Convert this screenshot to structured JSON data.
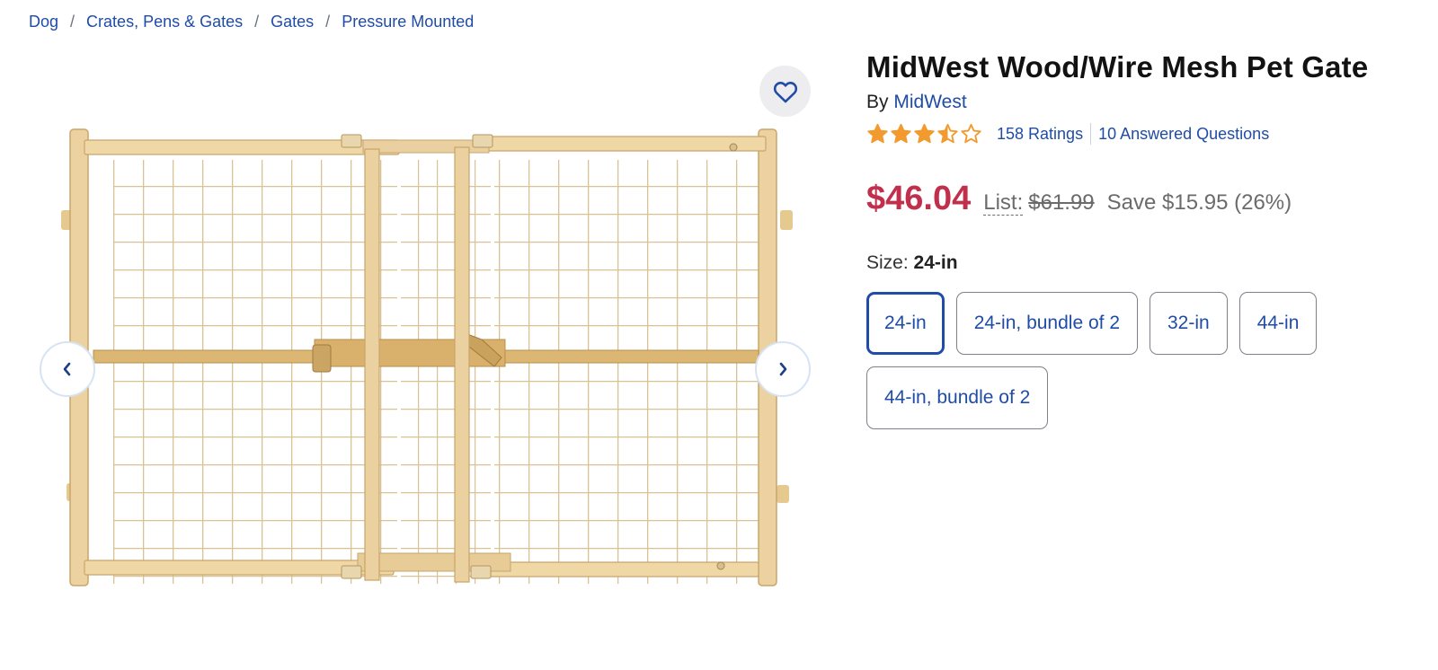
{
  "breadcrumb": [
    "Dog",
    "Crates, Pens & Gates",
    "Gates",
    "Pressure Mounted"
  ],
  "breadcrumb_separator": "/",
  "product": {
    "title": "MidWest Wood/Wire Mesh Pet Gate",
    "by_label": "By",
    "brand": "MidWest",
    "rating": 3.5,
    "rating_max": 5,
    "ratings_text": "158 Ratings",
    "questions_text": "10 Answered Questions"
  },
  "pricing": {
    "price": "$46.04",
    "list_label": "List:",
    "list_price": "$61.99",
    "save_text": "Save $15.95 (26%)"
  },
  "size": {
    "label": "Size:",
    "selected": "24-in",
    "options": [
      "24-in",
      "24-in, bundle of 2",
      "32-in",
      "44-in",
      "44-in, bundle of 2"
    ]
  },
  "icons": {
    "favorite": "heart-outline-icon",
    "prev": "chevron-left-icon",
    "next": "chevron-right-icon",
    "star": "star-icon"
  },
  "colors": {
    "link": "#1f4ca6",
    "price": "#c0304d",
    "star": "#f29a2e",
    "fav_background": "#ededf0"
  }
}
